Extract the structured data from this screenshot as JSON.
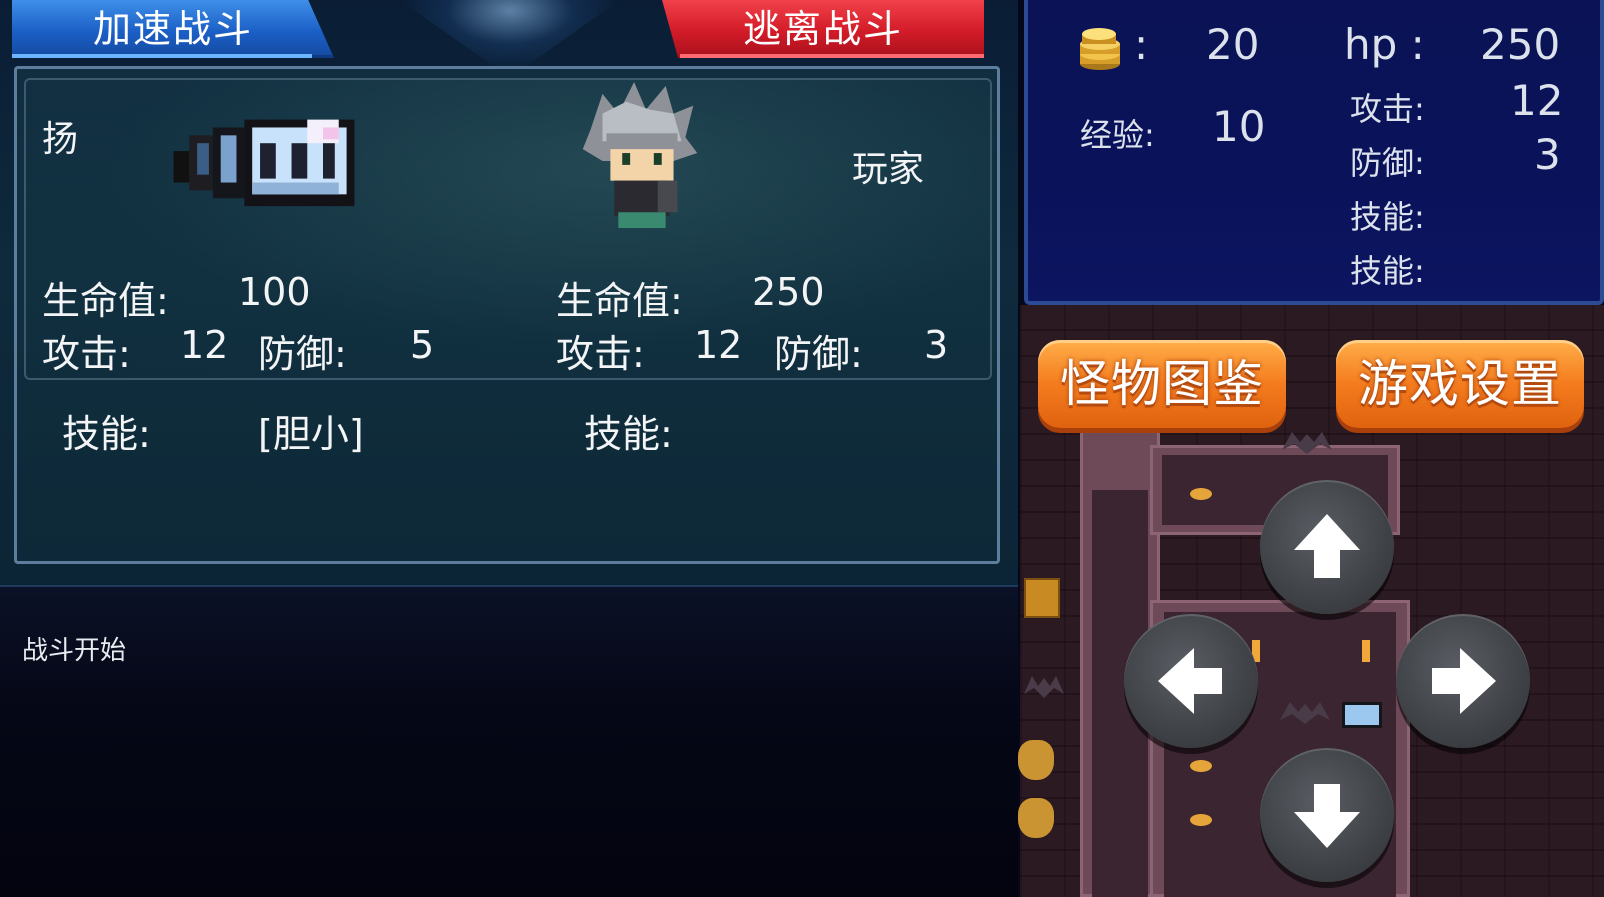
{
  "battle": {
    "speed_button": "加速战斗",
    "escape_button": "逃离战斗",
    "enemy": {
      "name": "扬",
      "hp_label": "生命值:",
      "hp": "100",
      "atk_label": "攻击:",
      "atk": "12",
      "def_label": "防御:",
      "def": "5",
      "skill_label": "技能:",
      "skill": "[胆小]"
    },
    "player": {
      "name": "玩家",
      "hp_label": "生命值:",
      "hp": "250",
      "atk_label": "攻击:",
      "atk": "12",
      "def_label": "防御:",
      "def": "3",
      "skill_label": "技能:",
      "skill": ""
    }
  },
  "log": {
    "message": "战斗开始"
  },
  "status": {
    "gold_sep": ":",
    "gold": "20",
    "hp_label": "hp :",
    "hp": "250",
    "exp_label": "经验:",
    "exp": "10",
    "atk_label": "攻击:",
    "atk": "12",
    "def_label": "防御:",
    "def": "3",
    "skill1_label": "技能:",
    "skill2_label": "技能:"
  },
  "menu": {
    "monster_book": "怪物图鉴",
    "game_settings": "游戏设置"
  },
  "controls": {
    "up": "arrow-up-icon",
    "left": "arrow-left-icon",
    "right": "arrow-right-icon",
    "down": "arrow-down-icon"
  },
  "colors": {
    "speed_button": "#1b5fc6",
    "escape_button": "#d21b28",
    "menu_button": "#f47c1e",
    "info_panel": "#0a125a"
  }
}
